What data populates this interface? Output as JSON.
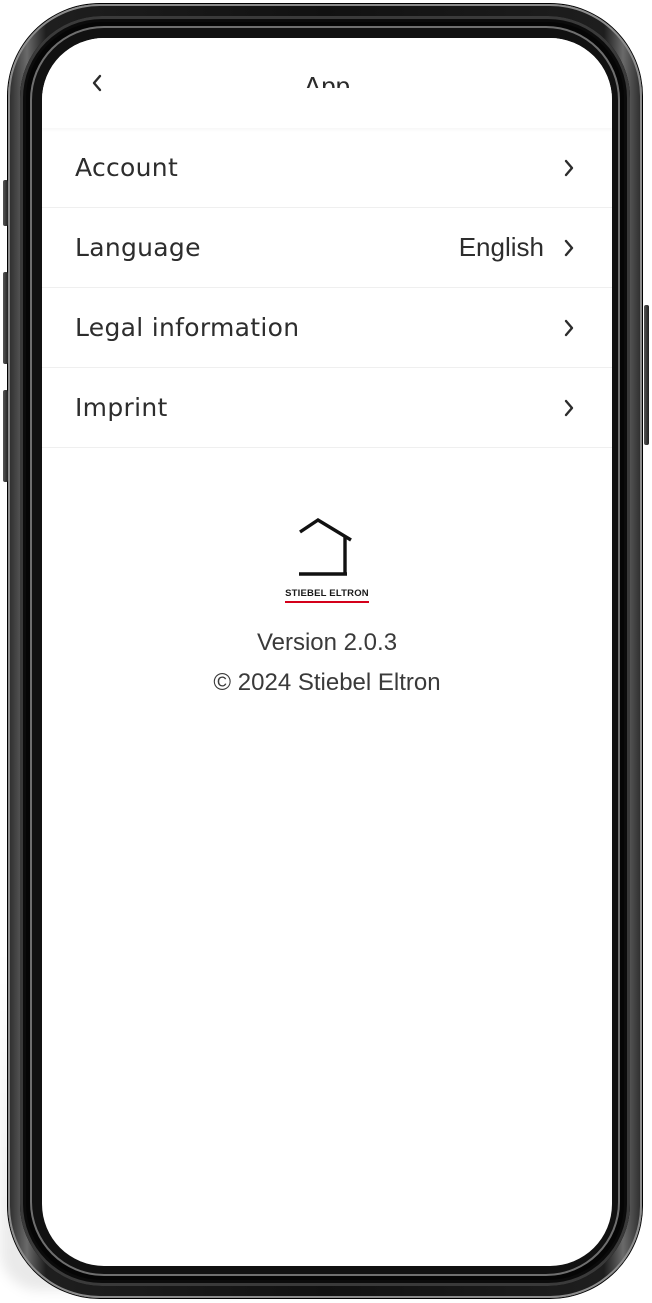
{
  "header": {
    "back_icon": "chevron-left-icon",
    "title": "App"
  },
  "menu": {
    "items": [
      {
        "label": "Account",
        "value": "",
        "icon": "chevron-right-icon"
      },
      {
        "label": "Language",
        "value": "English",
        "icon": "chevron-right-icon"
      },
      {
        "label": "Legal information",
        "value": "",
        "icon": "chevron-right-icon"
      },
      {
        "label": "Imprint",
        "value": "",
        "icon": "chevron-right-icon"
      }
    ]
  },
  "brand": {
    "logo_icon": "stiebel-eltron-house-logo",
    "logo_text": "STIEBEL ELTRON",
    "accent_color": "#d4001a",
    "version": "Version 2.0.3",
    "copyright": "© 2024 Stiebel Eltron"
  }
}
